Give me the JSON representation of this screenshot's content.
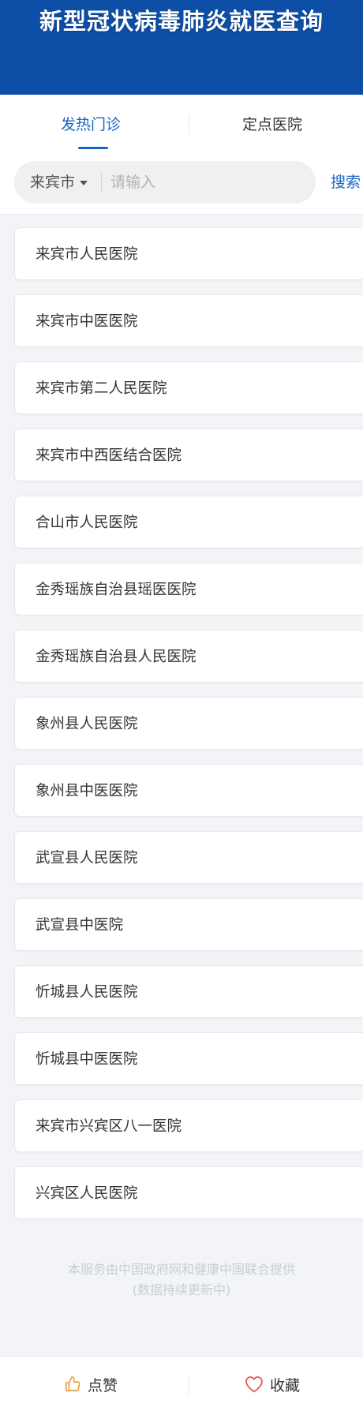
{
  "header": {
    "title": "新型冠状病毒肺炎就医查询",
    "bg_color": "#0d4fa6"
  },
  "tabs": [
    {
      "label": "发热门诊",
      "active": true
    },
    {
      "label": "定点医院",
      "active": false
    }
  ],
  "search": {
    "city": "来宾市",
    "placeholder": "请输入",
    "value": "",
    "button_label": "搜索"
  },
  "hospitals": [
    "来宾市人民医院",
    "来宾市中医医院",
    "来宾市第二人民医院",
    "来宾市中西医结合医院",
    "合山市人民医院",
    "金秀瑶族自治县瑶医医院",
    "金秀瑶族自治县人民医院",
    "象州县人民医院",
    "象州县中医医院",
    "武宣县人民医院",
    "武宣县中医院",
    "忻城县人民医院",
    "忻城县中医医院",
    "来宾市兴宾区八一医院",
    "兴宾区人民医院"
  ],
  "footer": {
    "line1": "本服务由中国政府网和健康中国联合提供",
    "line2": "(数据持续更新中)"
  },
  "bottom_bar": {
    "like_label": "点赞",
    "like_icon": "thumbs-up-icon",
    "like_color": "#e6a23c",
    "favorite_label": "收藏",
    "favorite_icon": "heart-icon",
    "favorite_color": "#e05a5a"
  },
  "colors": {
    "accent": "#1a64c4",
    "background": "#f2f4f7"
  }
}
